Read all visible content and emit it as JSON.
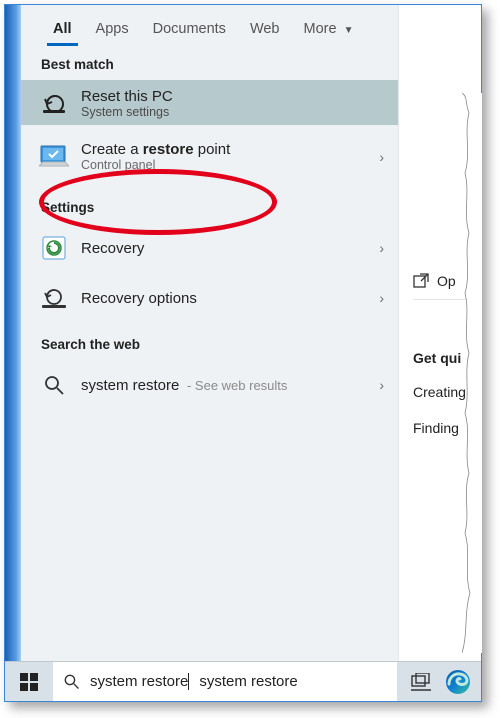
{
  "tabs": {
    "all": "All",
    "apps": "Apps",
    "documents": "Documents",
    "web": "Web",
    "more": "More"
  },
  "sections": {
    "best_match": "Best match",
    "settings": "Settings",
    "search_web": "Search the web"
  },
  "best_match": {
    "title": "Reset this PC",
    "sub": "System settings"
  },
  "results": {
    "restore_point": {
      "title_pre": "Create a ",
      "title_bold": "restore",
      "title_post": " point",
      "sub": "Control panel"
    },
    "recovery": {
      "title": "Recovery"
    },
    "recovery_options": {
      "title": "Recovery options"
    },
    "web": {
      "title": "system restore",
      "suffix": " - See web results"
    }
  },
  "side": {
    "open": "Op",
    "getqui": "Get qui",
    "creating": "Creating",
    "finding": "Finding"
  },
  "search": {
    "value": "system restore"
  }
}
